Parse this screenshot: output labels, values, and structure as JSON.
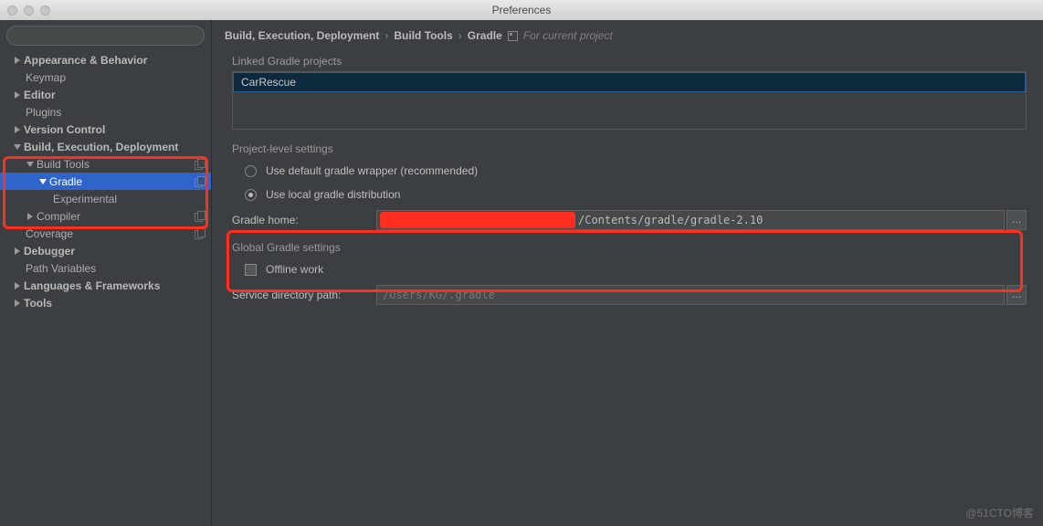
{
  "window": {
    "title": "Preferences"
  },
  "sidebar": {
    "search_placeholder": "",
    "items": {
      "appearance": "Appearance & Behavior",
      "keymap": "Keymap",
      "editor": "Editor",
      "plugins": "Plugins",
      "vcs": "Version Control",
      "bed": "Build, Execution, Deployment",
      "build_tools": "Build Tools",
      "gradle": "Gradle",
      "experimental": "Experimental",
      "compiler": "Compiler",
      "coverage": "Coverage",
      "debugger": "Debugger",
      "path_vars": "Path Variables",
      "lang_fw": "Languages & Frameworks",
      "tools": "Tools"
    }
  },
  "breadcrumb": {
    "a": "Build, Execution, Deployment",
    "b": "Build Tools",
    "c": "Gradle",
    "note": "For current project"
  },
  "main": {
    "linked_label": "Linked Gradle projects",
    "linked_project": "CarRescue",
    "project_level": "Project-level settings",
    "radio_default": "Use default gradle wrapper (recommended)",
    "radio_local": "Use local gradle distribution",
    "gradle_home_label": "Gradle home:",
    "gradle_home_value": "/Contents/gradle/gradle-2.10",
    "global_label": "Global Gradle settings",
    "offline_label": "Offline work",
    "service_dir_label": "Service directory path:",
    "service_dir_value": "/Users/KG/.gradle"
  },
  "watermark": "@51CTO博客"
}
